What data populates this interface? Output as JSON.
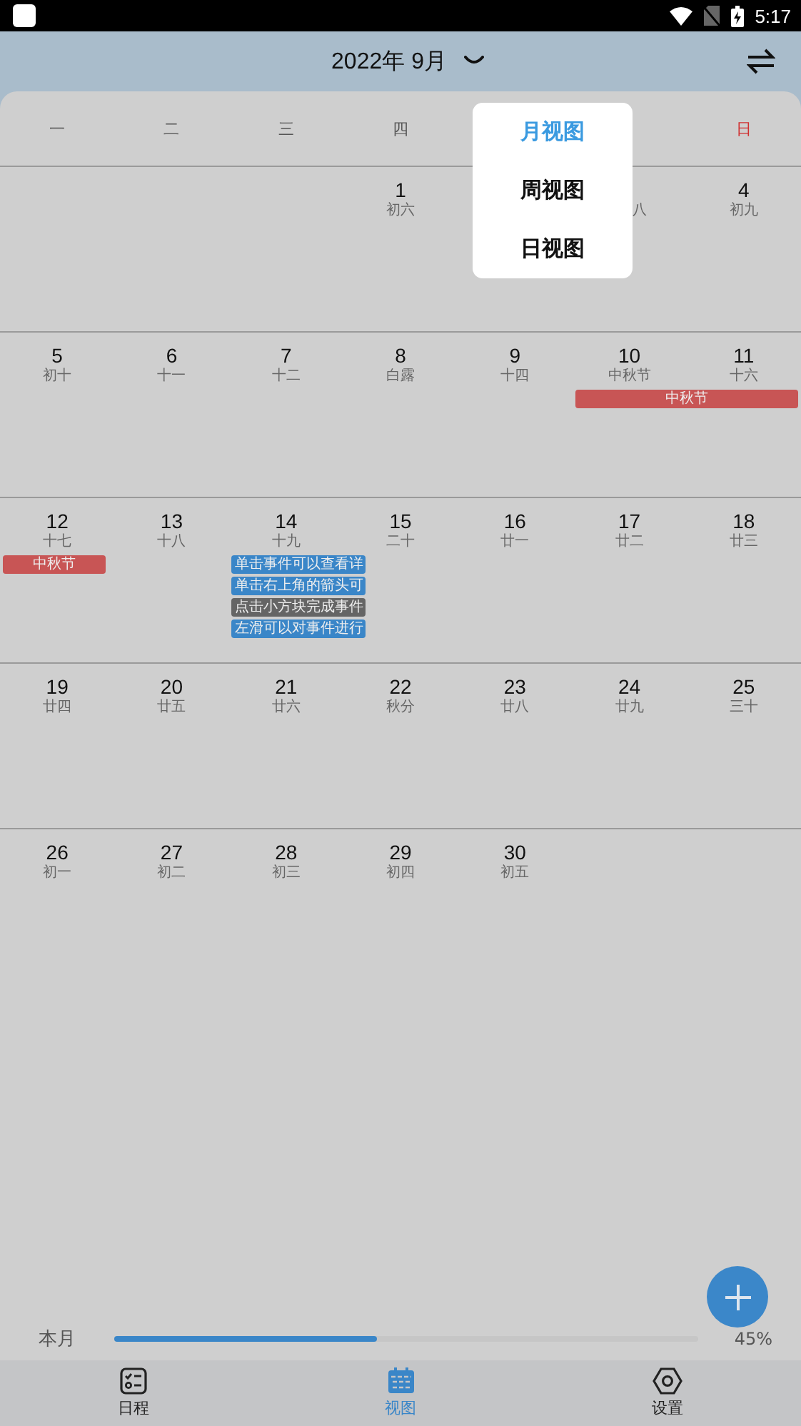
{
  "status_bar": {
    "time": "5:17"
  },
  "header": {
    "title": "2022年 9月"
  },
  "weekdays": [
    {
      "label": "一",
      "weekend": false
    },
    {
      "label": "二",
      "weekend": false
    },
    {
      "label": "三",
      "weekend": false
    },
    {
      "label": "四",
      "weekend": false
    },
    {
      "label": "日",
      "weekend": true
    }
  ],
  "weeks": [
    {
      "days": [
        {
          "kind": "empty"
        },
        {
          "kind": "empty"
        },
        {
          "kind": "empty"
        },
        {
          "kind": "date",
          "day": "1",
          "lunar": "初六"
        },
        {
          "kind": "covered"
        },
        {
          "kind": "covered",
          "lunar": "八"
        },
        {
          "kind": "date",
          "day": "4",
          "lunar": "初九"
        }
      ]
    },
    {
      "days": [
        {
          "day": "5",
          "lunar": "初十"
        },
        {
          "day": "6",
          "lunar": "十一"
        },
        {
          "day": "7",
          "lunar": "十二"
        },
        {
          "day": "8",
          "lunar": "白露"
        },
        {
          "day": "9",
          "lunar": "十四"
        },
        {
          "day": "10",
          "lunar": "中秋节",
          "events": [
            {
              "title": "中秋节",
              "color": "#c85555",
              "spans_next_day": true
            }
          ]
        },
        {
          "day": "11",
          "lunar": "十六"
        }
      ]
    },
    {
      "days": [
        {
          "day": "12",
          "lunar": "十七",
          "events": [
            {
              "title": "中秋节",
              "color": "#c85555",
              "spans_next_day": false
            }
          ]
        },
        {
          "day": "13",
          "lunar": "十八"
        },
        {
          "day": "14",
          "lunar": "十九",
          "events": [
            {
              "title": "单击事件可以查看详",
              "color": "#3a86c8",
              "spans_next_day": false
            },
            {
              "title": "单击右上角的箭头可",
              "color": "#3a86c8",
              "spans_next_day": false
            },
            {
              "title": "点击小方块完成事件",
              "color": "#656565",
              "spans_next_day": false
            },
            {
              "title": "左滑可以对事件进行",
              "color": "#3a86c8",
              "spans_next_day": false
            }
          ]
        },
        {
          "day": "15",
          "lunar": "二十"
        },
        {
          "day": "16",
          "lunar": "廿一"
        },
        {
          "day": "17",
          "lunar": "廿二"
        },
        {
          "day": "18",
          "lunar": "廿三"
        }
      ]
    },
    {
      "days": [
        {
          "day": "19",
          "lunar": "廿四"
        },
        {
          "day": "20",
          "lunar": "廿五"
        },
        {
          "day": "21",
          "lunar": "廿六"
        },
        {
          "day": "22",
          "lunar": "秋分"
        },
        {
          "day": "23",
          "lunar": "廿八"
        },
        {
          "day": "24",
          "lunar": "廿九"
        },
        {
          "day": "25",
          "lunar": "三十"
        }
      ]
    },
    {
      "days": [
        {
          "day": "26",
          "lunar": "初一"
        },
        {
          "day": "27",
          "lunar": "初二"
        },
        {
          "day": "28",
          "lunar": "初三"
        },
        {
          "day": "29",
          "lunar": "初四"
        },
        {
          "day": "30",
          "lunar": "初五"
        },
        {
          "kind": "empty"
        },
        {
          "kind": "empty"
        }
      ]
    }
  ],
  "view_menu": [
    {
      "label": "月视图",
      "selected": true
    },
    {
      "label": "周视图",
      "selected": false
    },
    {
      "label": "日视图",
      "selected": false
    }
  ],
  "progress": {
    "label": "本月",
    "level": 0.45,
    "reading": "45%"
  },
  "bottom_nav": [
    {
      "label": "日程",
      "kind": "schedule",
      "selected": false
    },
    {
      "label": "视图",
      "kind": "calendar",
      "selected": true
    },
    {
      "label": "设置",
      "kind": "settings",
      "selected": false
    }
  ]
}
